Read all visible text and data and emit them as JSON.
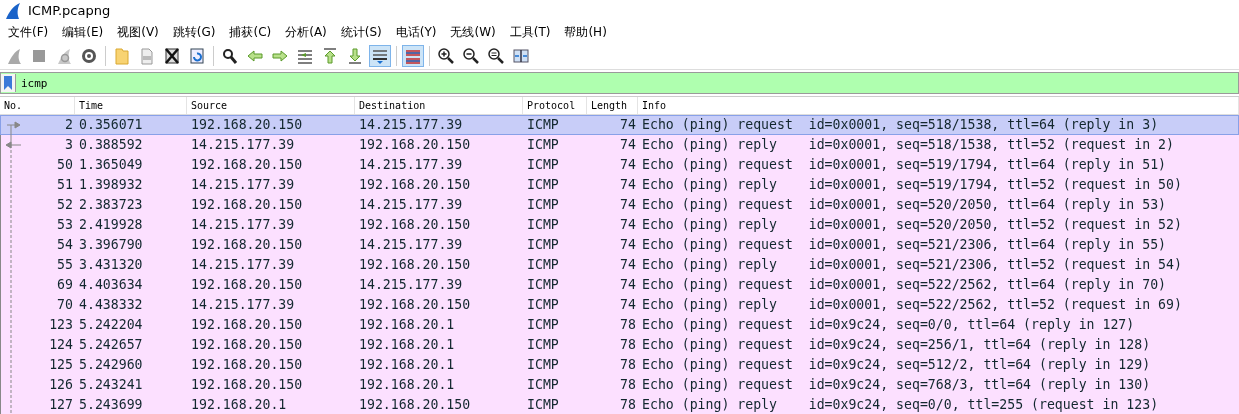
{
  "window": {
    "title": "ICMP.pcapng"
  },
  "menu": [
    "文件(F)",
    "编辑(E)",
    "视图(V)",
    "跳转(G)",
    "捕获(C)",
    "分析(A)",
    "统计(S)",
    "电话(Y)",
    "无线(W)",
    "工具(T)",
    "帮助(H)"
  ],
  "toolbar": [
    [
      {
        "kind": "fin",
        "pressed": false
      },
      {
        "kind": "stop",
        "pressed": false
      },
      {
        "kind": "restart",
        "pressed": false
      },
      {
        "kind": "options",
        "pressed": false
      }
    ],
    [
      {
        "kind": "open",
        "pressed": false
      },
      {
        "kind": "save",
        "pressed": false
      },
      {
        "kind": "close",
        "pressed": false
      },
      {
        "kind": "reload",
        "pressed": false
      }
    ],
    [
      {
        "kind": "find",
        "pressed": false
      },
      {
        "kind": "back",
        "pressed": false
      },
      {
        "kind": "forward",
        "pressed": false
      },
      {
        "kind": "goto",
        "pressed": false
      },
      {
        "kind": "first",
        "pressed": false
      },
      {
        "kind": "last",
        "pressed": false
      },
      {
        "kind": "autoscroll",
        "pressed": true
      }
    ],
    [
      {
        "kind": "colorize",
        "pressed": true
      }
    ],
    [
      {
        "kind": "zoom-in",
        "pressed": false
      },
      {
        "kind": "zoom-out",
        "pressed": false
      },
      {
        "kind": "zoom-reset",
        "pressed": false
      },
      {
        "kind": "resize",
        "pressed": false
      }
    ]
  ],
  "filter": {
    "value": "icmp"
  },
  "table": {
    "columns": [
      "No.",
      "Time",
      "Source",
      "Destination",
      "Protocol",
      "Length",
      "Info"
    ],
    "rows": [
      {
        "cells": [
          "2",
          "0.356071",
          "192.168.20.150",
          "14.215.177.39",
          "ICMP",
          "74",
          "Echo (ping) request  id=0x0001, seq=518/1538, ttl=64 (reply in 3)"
        ],
        "selected": true,
        "kind": "request"
      },
      {
        "cells": [
          "3",
          "0.388592",
          "14.215.177.39",
          "192.168.20.150",
          "ICMP",
          "74",
          "Echo (ping) reply    id=0x0001, seq=518/1538, ttl=52 (request in 2)"
        ],
        "selected": false,
        "kind": "reply"
      },
      {
        "cells": [
          "50",
          "1.365049",
          "192.168.20.150",
          "14.215.177.39",
          "ICMP",
          "74",
          "Echo (ping) request  id=0x0001, seq=519/1794, ttl=64 (reply in 51)"
        ],
        "selected": false
      },
      {
        "cells": [
          "51",
          "1.398932",
          "14.215.177.39",
          "192.168.20.150",
          "ICMP",
          "74",
          "Echo (ping) reply    id=0x0001, seq=519/1794, ttl=52 (request in 50)"
        ],
        "selected": false
      },
      {
        "cells": [
          "52",
          "2.383723",
          "192.168.20.150",
          "14.215.177.39",
          "ICMP",
          "74",
          "Echo (ping) request  id=0x0001, seq=520/2050, ttl=64 (reply in 53)"
        ],
        "selected": false
      },
      {
        "cells": [
          "53",
          "2.419928",
          "14.215.177.39",
          "192.168.20.150",
          "ICMP",
          "74",
          "Echo (ping) reply    id=0x0001, seq=520/2050, ttl=52 (request in 52)"
        ],
        "selected": false
      },
      {
        "cells": [
          "54",
          "3.396790",
          "192.168.20.150",
          "14.215.177.39",
          "ICMP",
          "74",
          "Echo (ping) request  id=0x0001, seq=521/2306, ttl=64 (reply in 55)"
        ],
        "selected": false
      },
      {
        "cells": [
          "55",
          "3.431320",
          "14.215.177.39",
          "192.168.20.150",
          "ICMP",
          "74",
          "Echo (ping) reply    id=0x0001, seq=521/2306, ttl=52 (request in 54)"
        ],
        "selected": false
      },
      {
        "cells": [
          "69",
          "4.403634",
          "192.168.20.150",
          "14.215.177.39",
          "ICMP",
          "74",
          "Echo (ping) request  id=0x0001, seq=522/2562, ttl=64 (reply in 70)"
        ],
        "selected": false
      },
      {
        "cells": [
          "70",
          "4.438332",
          "14.215.177.39",
          "192.168.20.150",
          "ICMP",
          "74",
          "Echo (ping) reply    id=0x0001, seq=522/2562, ttl=52 (request in 69)"
        ],
        "selected": false
      },
      {
        "cells": [
          "123",
          "5.242204",
          "192.168.20.150",
          "192.168.20.1",
          "ICMP",
          "78",
          "Echo (ping) request  id=0x9c24, seq=0/0, ttl=64 (reply in 127)"
        ],
        "selected": false
      },
      {
        "cells": [
          "124",
          "5.242657",
          "192.168.20.150",
          "192.168.20.1",
          "ICMP",
          "78",
          "Echo (ping) request  id=0x9c24, seq=256/1, ttl=64 (reply in 128)"
        ],
        "selected": false
      },
      {
        "cells": [
          "125",
          "5.242960",
          "192.168.20.150",
          "192.168.20.1",
          "ICMP",
          "78",
          "Echo (ping) request  id=0x9c24, seq=512/2, ttl=64 (reply in 129)"
        ],
        "selected": false
      },
      {
        "cells": [
          "126",
          "5.243241",
          "192.168.20.150",
          "192.168.20.1",
          "ICMP",
          "78",
          "Echo (ping) request  id=0x9c24, seq=768/3, ttl=64 (reply in 130)"
        ],
        "selected": false
      },
      {
        "cells": [
          "127",
          "5.243699",
          "192.168.20.1",
          "192.168.20.150",
          "ICMP",
          "78",
          "Echo (ping) reply    id=0x9c24, seq=0/0, ttl=255 (request in 123)"
        ],
        "selected": false
      }
    ]
  }
}
